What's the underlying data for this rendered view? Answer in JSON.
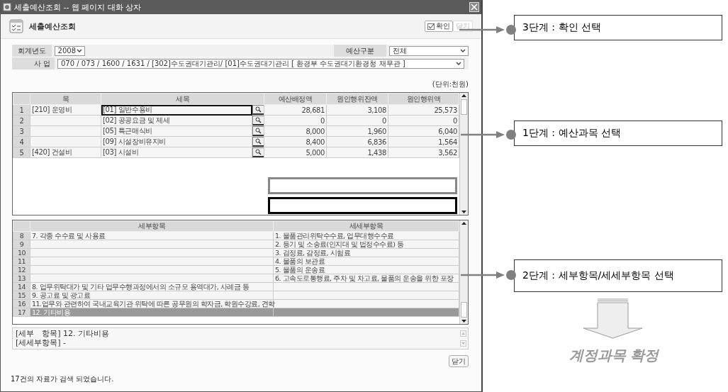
{
  "window": {
    "title": "세출예산조회 -- 웹 페이지 대화 상자"
  },
  "header": {
    "title": "세출예산조회",
    "buttons": [
      {
        "label": "확인",
        "kind": "confirm"
      },
      {
        "label": "닫기",
        "kind": "faded"
      }
    ]
  },
  "form": {
    "year": {
      "label": "회계년도",
      "value": "2008"
    },
    "category": {
      "label": "예산구분",
      "value": "전체"
    },
    "project": {
      "label": "사 업",
      "value": "070 / 073 / 1600 / 1631 / [302]수도권대기관리/ [01]수도권대기관리 [ 환경부 수도권대기환경청 재무관 ]"
    }
  },
  "unit": "(단위:천원)",
  "budget_table": {
    "columns": [
      "목",
      "세목",
      "예산배정액",
      "원인행위잔액",
      "원인행위액"
    ],
    "rows": [
      {
        "no": "1",
        "mok": "[210] 운영비",
        "semok": "[01] 일반수용비",
        "allocated": "28,681",
        "remaining": "3,108",
        "executed": "25,573",
        "highlighted": true
      },
      {
        "no": "2",
        "mok": "",
        "semok": "[02] 공공요금 및 제세",
        "allocated": "0",
        "remaining": "0",
        "executed": "0",
        "highlighted": false
      },
      {
        "no": "3",
        "mok": "",
        "semok": "[05] 특근매식비",
        "allocated": "8,000",
        "remaining": "1,960",
        "executed": "6,040",
        "highlighted": false
      },
      {
        "no": "4",
        "mok": "",
        "semok": "[09] 시설장비유지비",
        "allocated": "8,400",
        "remaining": "6,836",
        "executed": "1,564",
        "highlighted": false
      },
      {
        "no": "5",
        "mok": "[420] 건설비",
        "semok": "[03] 시설비",
        "allocated": "5,000",
        "remaining": "1,438",
        "executed": "3,562",
        "highlighted": false
      }
    ]
  },
  "detail_table": {
    "columns": [
      "세부항목",
      "세세부항목"
    ],
    "rows": [
      {
        "no": "8",
        "item": "7. 각종 수수료 및 사용료",
        "subitem": "1. 물품관리위탁수수료, 업무대행수수료",
        "selected": false
      },
      {
        "no": "9",
        "item": "",
        "subitem": "2. 등기 및 소송료(인지대 및 법정수수료) 등",
        "selected": false
      },
      {
        "no": "10",
        "item": "",
        "subitem": "3. 검정료, 감정료, 시험료",
        "selected": false
      },
      {
        "no": "11",
        "item": "",
        "subitem": "4. 물품의 보관료",
        "selected": false
      },
      {
        "no": "12",
        "item": "",
        "subitem": "5. 물품의 운송료",
        "selected": false
      },
      {
        "no": "13",
        "item": "",
        "subitem": "6. 고속도로통행료, 주차 및 차고료, 물품의 운송을 위한 포장",
        "selected": false
      },
      {
        "no": "14",
        "item": "8. 업무위탁대가 및 기타 업무수행과정에서의 소규모 용역대가, 사례금 등",
        "subitem": "",
        "selected": false
      },
      {
        "no": "15",
        "item": "9. 공고료 및 광고료",
        "subitem": "",
        "selected": false
      },
      {
        "no": "16",
        "item": "11.업무와 관련하여 국내교육기관 위탁에 따른 공무원의 학자금, 학원수강료, 견학",
        "subitem": "",
        "selected": false
      },
      {
        "no": "17",
        "item": "12. 기타비용",
        "subitem": "",
        "selected": true
      }
    ]
  },
  "detail_text": [
    "[세부　항목] 12. 기타비용",
    "[세세부항목] -"
  ],
  "close_button": "닫기",
  "status": "17건의 자료가 검색 되었습니다.",
  "callouts": [
    {
      "text": "3단계 : 확인 선택"
    },
    {
      "text": "1단계 : 예산과목 선택"
    },
    {
      "text": "2단계 : 세부항목/세세부항목 선택"
    }
  ],
  "result": "계정과목 확정"
}
